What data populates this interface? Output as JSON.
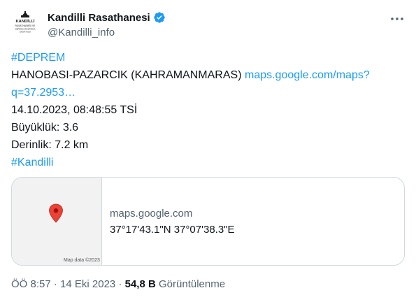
{
  "account": {
    "display_name": "Kandilli Rasathanesi",
    "handle": "@Kandilli_info",
    "avatar_text": [
      "KANDİLLİ",
      "RASATHANESİ VE",
      "DEPREM ARAŞTIRMA",
      "ENSTİTÜSÜ"
    ]
  },
  "post": {
    "hashtag_top": "#DEPREM",
    "location_text": "HANOBASI-PAZARCIK (KAHRAMANMARAS)",
    "link_part1": "maps.google.com/maps?",
    "link_part2": "q=37.2953…",
    "datetime": "14.10.2023, 08:48:55 TSİ",
    "magnitude": "Büyüklük: 3.6",
    "depth": "Derinlik: 7.2 km",
    "hashtag_bottom": "#Kandilli"
  },
  "card": {
    "domain": "maps.google.com",
    "title": "37°17'43.1\"N 37°07'38.3\"E",
    "map_credit": "Map data ©2023"
  },
  "meta": {
    "time": "ÖÖ 8:57",
    "separator": "·",
    "date": "14 Eki 2023",
    "view_count": "54,8 B",
    "view_label": "Görüntülenme"
  },
  "colors": {
    "link": "#1d9bf0",
    "secondary_text": "#536471",
    "pin": "#ea4335",
    "verified_badge": "#1d9bf0"
  },
  "icons": [
    "kandilli-logo-icon",
    "verified-badge-icon",
    "more-options-icon",
    "map-pin-icon"
  ]
}
